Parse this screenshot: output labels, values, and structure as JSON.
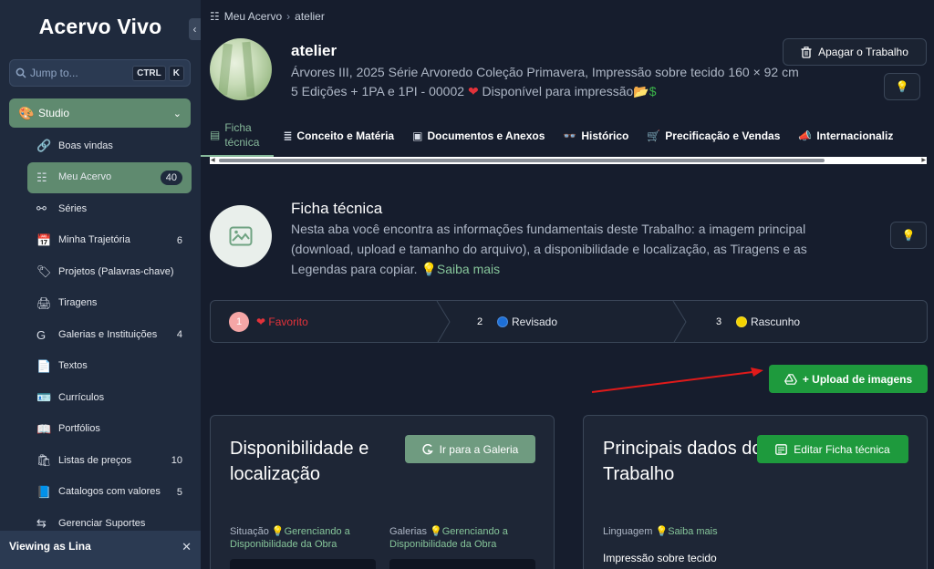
{
  "sidebar": {
    "brand": "Acervo Vivo",
    "collapse_icon": "‹",
    "search": {
      "placeholder": "Jump to...",
      "kbd1": "CTRL",
      "kbd2": "K"
    },
    "studio": {
      "label": "Studio"
    },
    "items": [
      {
        "label": "Boas vindas",
        "count": "",
        "icon": "🔗"
      },
      {
        "label": "Meu Acervo",
        "count": "40",
        "icon": "☷"
      },
      {
        "label": "Séries",
        "count": "",
        "icon": "⚯"
      },
      {
        "label": "Minha Trajetória",
        "count": "6",
        "icon": "📅"
      },
      {
        "label": "Projetos (Palavras-chave)",
        "count": "",
        "icon": "🏷"
      },
      {
        "label": "Tiragens",
        "count": "",
        "icon": "🖨"
      },
      {
        "label": "Galerias e Instituições",
        "count": "4",
        "icon": "G"
      },
      {
        "label": "Textos",
        "count": "",
        "icon": "📄"
      },
      {
        "label": "Currículos",
        "count": "",
        "icon": "🪪"
      },
      {
        "label": "Portfólios",
        "count": "",
        "icon": "📖"
      },
      {
        "label": "Listas de preços",
        "count": "10",
        "icon": "🛍"
      },
      {
        "label": "Catalogos com valores",
        "count": "5",
        "icon": "📘"
      },
      {
        "label": "Gerenciar Suportes",
        "count": "",
        "icon": "⇆"
      }
    ],
    "viewing": {
      "label": "Viewing as Lina",
      "close": "✕"
    }
  },
  "header": {
    "breadcrumb": [
      "Meu Acervo",
      "atelier"
    ],
    "breadcrumb_sep": "›",
    "title": "atelier",
    "subtitle_main": "Árvores III, 2025 Série Arvoredo Coleção Primavera, Impressão sobre tecido 160 × 92 cm 5 Edições + 1PA e 1PI - 00002",
    "subtitle_heart": "❤",
    "subtitle_tail": " Disponível para impressão",
    "subtitle_icons": "📂",
    "subtitle_dollar": "$",
    "delete_label": "Apagar o Trabalho",
    "bulb": "💡"
  },
  "tabs": [
    {
      "label": "Ficha técnica",
      "icon": "▤"
    },
    {
      "label": "Conceito e Matéria",
      "icon": "≣"
    },
    {
      "label": "Documentos e Anexos",
      "icon": "▣"
    },
    {
      "label": "Histórico",
      "icon": "👓"
    },
    {
      "label": "Precificação e Vendas",
      "icon": "🛒"
    },
    {
      "label": "Internacionaliz",
      "icon": "📣"
    }
  ],
  "section": {
    "title": "Ficha técnica",
    "desc": "Nesta aba você encontra as informações fundamentais deste Trabalho: a imagem principal (download, upload e tamanho do arquivo), a disponibilidade e localização, as Tiragens e as Legendas para copiar.",
    "more": "💡Saiba mais"
  },
  "steps": [
    {
      "num": "1",
      "label": "❤ Favorito",
      "color": "#e2323a"
    },
    {
      "num": "2",
      "label": "Revisado",
      "color": "#1d6fd6"
    },
    {
      "num": "3",
      "label": "Rascunho",
      "color": "#f4d400"
    }
  ],
  "upload_label": "+ Upload de imagens",
  "card_left": {
    "title": "Disponibilidade e localização",
    "button": "Ir para a Galeria",
    "field1_label": "Situação",
    "field1_hint": "💡Gerenciando a Disponibilidade da Obra",
    "field2_label": "Galerias",
    "field2_hint": "💡Gerenciando a Disponibilidade da Obra"
  },
  "card_right": {
    "title": "Principais dados do Trabalho",
    "button": "Editar Ficha técnica",
    "field_label": "Linguagem",
    "field_hint": "💡Saiba mais",
    "field_value": "Impressão sobre tecido"
  }
}
